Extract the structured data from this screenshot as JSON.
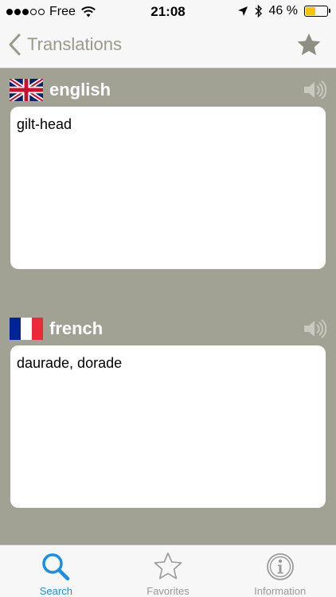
{
  "status_bar": {
    "carrier": "Free",
    "time": "21:08",
    "battery_percent": "46 %",
    "battery_level": 0.46,
    "signal_bars": 3,
    "signal_total": 5
  },
  "nav": {
    "back_label": "Translations"
  },
  "source": {
    "language": "english",
    "text": "gilt-head"
  },
  "target": {
    "language": "french",
    "text": "daurade, dorade"
  },
  "tabs": [
    {
      "label": "Search",
      "icon": "search-icon",
      "active": true
    },
    {
      "label": "Favorites",
      "icon": "star-icon",
      "active": false
    },
    {
      "label": "Information",
      "icon": "info-icon",
      "active": false
    }
  ],
  "colors": {
    "background": "#a1a294",
    "accent": "#1a8fe3",
    "nav_tint": "#9a9a8c"
  }
}
